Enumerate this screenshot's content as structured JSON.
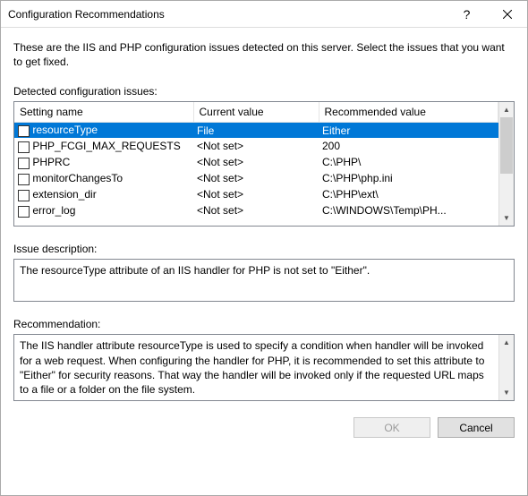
{
  "window": {
    "title": "Configuration Recommendations",
    "help_glyph": "?",
    "close_label": "Close"
  },
  "intro": "These are the IIS and PHP configuration issues detected on this server. Select the issues that you want to get fixed.",
  "issues_label": "Detected configuration issues:",
  "columns": {
    "setting": "Setting name",
    "current": "Current value",
    "recommended": "Recommended value"
  },
  "rows": [
    {
      "setting": "resourceType",
      "current": "File",
      "recommended": "Either",
      "selected": true
    },
    {
      "setting": "PHP_FCGI_MAX_REQUESTS",
      "current": "<Not set>",
      "recommended": "200",
      "selected": false
    },
    {
      "setting": "PHPRC",
      "current": "<Not set>",
      "recommended": "C:\\PHP\\",
      "selected": false
    },
    {
      "setting": "monitorChangesTo",
      "current": "<Not set>",
      "recommended": "C:\\PHP\\php.ini",
      "selected": false
    },
    {
      "setting": "extension_dir",
      "current": "<Not set>",
      "recommended": "C:\\PHP\\ext\\",
      "selected": false
    },
    {
      "setting": "error_log",
      "current": "<Not set>",
      "recommended": "C:\\WINDOWS\\Temp\\PH...",
      "selected": false
    }
  ],
  "desc_label": "Issue description:",
  "desc_text": "The resourceType attribute of an IIS handler for PHP is not set to \"Either\".",
  "rec_label": "Recommendation:",
  "rec_text": "The IIS handler attribute resourceType is used to specify a condition when handler will be invoked for a web request. When configuring the handler for PHP, it is recommended to set this attribute to \"Either\" for security reasons. That way the handler will be invoked only if the requested URL maps to a file or a folder on the file system.",
  "buttons": {
    "ok": "OK",
    "cancel": "Cancel"
  }
}
